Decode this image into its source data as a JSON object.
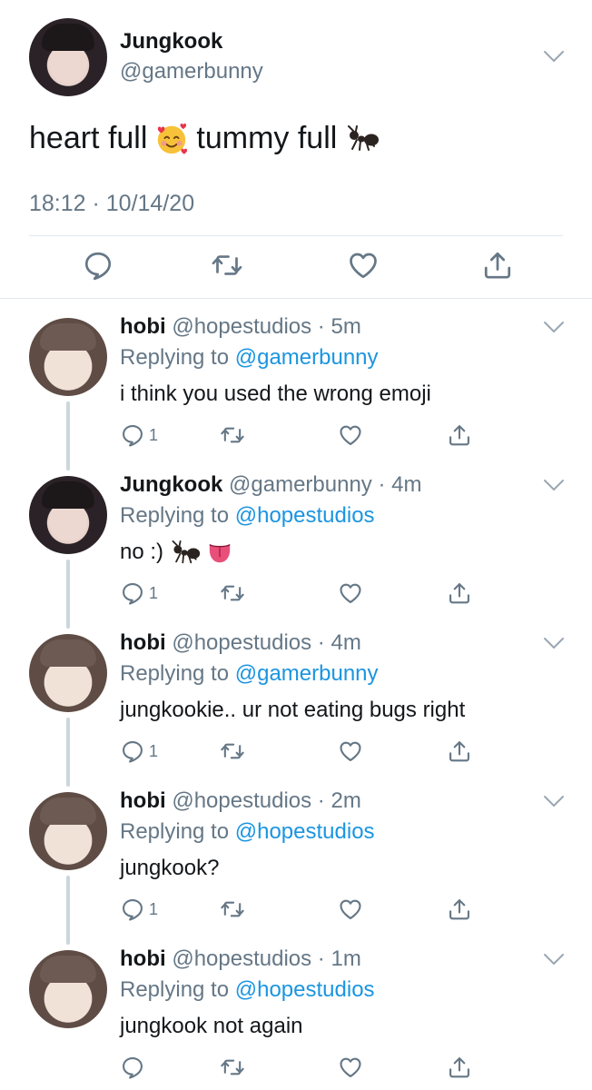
{
  "tweet": {
    "name": "Jungkook",
    "handle": "@gamerbunny",
    "text_part1": "heart full",
    "text_part2": "tummy full",
    "emoji_1": "smiling-face-with-hearts",
    "emoji_2": "ant",
    "timestamp": "18:12 · 10/14/20",
    "actions": [
      "reply-icon",
      "retweet-icon",
      "like-icon",
      "share-icon"
    ]
  },
  "replies": [
    {
      "name": "hobi",
      "handle": "@hopestudios",
      "dot": "·",
      "time": "5m",
      "replying_prefix": "Replying to",
      "replying_to": "@gamerbunny",
      "text": "i think you used the wrong emoji",
      "reply_count": "1"
    },
    {
      "name": "Jungkook",
      "handle": "@gamerbunny",
      "dot": "·",
      "time": "4m",
      "replying_prefix": "Replying to",
      "replying_to": "@hopestudios",
      "text": "no :)",
      "emojis": [
        "ant",
        "tongue"
      ],
      "reply_count": "1"
    },
    {
      "name": "hobi",
      "handle": "@hopestudios",
      "dot": "·",
      "time": "4m",
      "replying_prefix": "Replying to",
      "replying_to": "@gamerbunny",
      "text": "jungkookie.. ur not eating bugs right",
      "reply_count": "1"
    },
    {
      "name": "hobi",
      "handle": "@hopestudios",
      "dot": "·",
      "time": "2m",
      "replying_prefix": "Replying to",
      "replying_to": "@hopestudios",
      "text": "jungkook?",
      "reply_count": "1"
    },
    {
      "name": "hobi",
      "handle": "@hopestudios",
      "dot": "·",
      "time": "1m",
      "replying_prefix": "Replying to",
      "replying_to": "@hopestudios",
      "text": "jungkook not again",
      "reply_count": ""
    }
  ],
  "colors": {
    "text": "#14171a",
    "secondary": "#657786",
    "link": "#1b95e0",
    "divider": "#e1e8ed",
    "thread_line": "#ccd6dd"
  }
}
